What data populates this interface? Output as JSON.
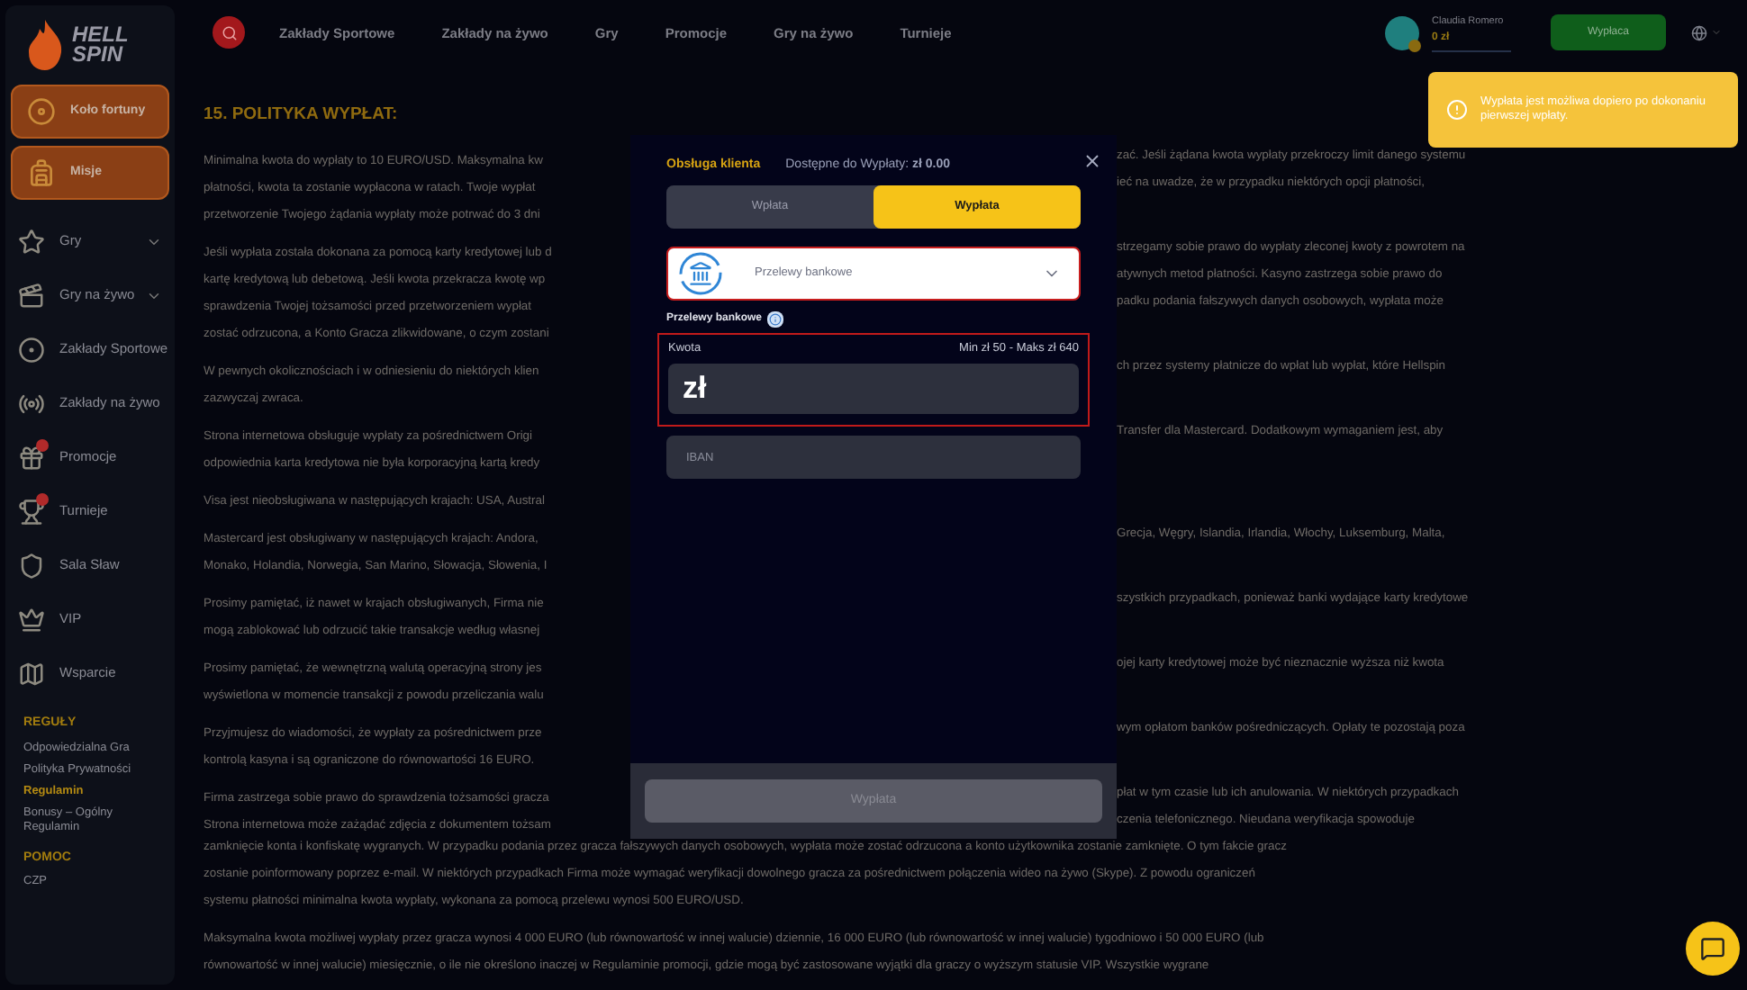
{
  "sidebar": {
    "logo": [
      "HELL",
      "SPIN"
    ],
    "promo_buttons": [
      "Koło fortuny",
      "Misje"
    ],
    "items": [
      {
        "label": "Gry",
        "submenu": true,
        "badge": false
      },
      {
        "label": "Gry na żywo",
        "submenu": true,
        "badge": false
      },
      {
        "label": "Zakłady Sportowe",
        "submenu": false,
        "badge": false
      },
      {
        "label": "Zakłady na żywo",
        "submenu": false,
        "badge": false
      },
      {
        "label": "Promocje",
        "submenu": false,
        "badge": true
      },
      {
        "label": "Turnieje",
        "submenu": false,
        "badge": true
      },
      {
        "label": "Sala Sław",
        "submenu": false,
        "badge": false
      },
      {
        "label": "VIP",
        "submenu": false,
        "badge": false
      },
      {
        "label": "Wsparcie",
        "submenu": false,
        "badge": false
      }
    ],
    "sections": [
      {
        "title": "REGUŁY",
        "links": [
          {
            "label": "Odpowiedzialna Gra",
            "selected": false
          },
          {
            "label": "Polityka Prywatności",
            "selected": false
          },
          {
            "label": "Regulamin",
            "selected": true
          },
          {
            "label": "Bonusy – Ogólny Regulamin",
            "selected": false
          }
        ]
      },
      {
        "title": "POMOC",
        "links": [
          {
            "label": "CZP",
            "selected": false
          }
        ]
      }
    ]
  },
  "top_nav": {
    "links": [
      "Zakłady Sportowe",
      "Zakłady na żywo",
      "Gry",
      "Promocje",
      "Gry na żywo",
      "Turnieje"
    ],
    "user": {
      "name": "Claudia Romero",
      "balance": "0 zł",
      "level": 0
    },
    "withdraw_button": "Wypłaca"
  },
  "toast": {
    "message": "Wypłata jest możliwa dopiero po dokonaniu pierwszej wpłaty."
  },
  "content": {
    "heading": "15. POLITYKA WYPŁAT:",
    "paragraphs": [
      [
        {
          "left": "Minimalna kwota do wypłaty to 10 EURO/USD. Maksymalna kw",
          "right": "zać. Jeśli żądana kwota wypłaty przekroczy limit danego systemu"
        },
        {
          "left": "płatności, kwota ta zostanie wypłacona w ratach. Twoje wypłat",
          "right": "ieć na uwadze, że w przypadku niektórych opcji płatności,"
        },
        {
          "left": "przetworzenie Twojego żądania wypłaty może potrwać do 3 dni"
        }
      ],
      [
        {
          "left": "Jeśli wypłata została dokonana za pomocą karty kredytowej lub d",
          "right": "strzegamy sobie prawo do wypłaty zleconej kwoty z powrotem na"
        },
        {
          "left": "kartę kredytową lub debetową. Jeśli kwota przekracza kwotę wp",
          "right": "atywnych metod płatności. Kasyno zastrzega sobie prawo do"
        },
        {
          "left": "sprawdzenia Twojej tożsamości przed przetworzeniem wypłat",
          "right": "padku podania fałszywych danych osobowych, wypłata może"
        },
        {
          "left": "zostać odrzucona, a Konto Gracza zlikwidowane, o czym zostani"
        }
      ],
      [
        {
          "left": "W pewnych okolicznościach i w odniesieniu do niektórych klien",
          "right": "ch przez systemy płatnicze do wpłat lub wypłat, które Hellspin"
        },
        {
          "left": "zazwyczaj zwraca."
        }
      ],
      [
        {
          "left": "Strona internetowa obsługuje wypłaty za pośrednictwem Origi",
          "right": "Transfer dla Mastercard. Dodatkowym wymaganiem jest, aby"
        },
        {
          "left": "odpowiednia karta kredytowa nie była korporacyjną kartą kredy"
        }
      ],
      [
        {
          "left": "Visa jest nieobsługiwana w następujących krajach: USA, Austral"
        }
      ],
      [
        {
          "left": "Mastercard jest obsługiwany w następujących krajach: Andora,",
          "right": "Grecja, Węgry, Islandia, Irlandia, Włochy, Luksemburg, Malta,"
        },
        {
          "left": "Monako, Holandia, Norwegia, San Marino, Słowacja, Słowenia, I"
        }
      ],
      [
        {
          "left": "Prosimy pamiętać, iż nawet w krajach obsługiwanych, Firma nie",
          "right": "szystkich przypadkach, ponieważ banki wydające karty kredytowe"
        },
        {
          "left": "mogą zablokować lub odrzucić takie transakcje według własnej"
        }
      ],
      [
        {
          "left": "Prosimy pamiętać, że wewnętrzną walutą operacyjną strony jes",
          "right": "ojej karty kredytowej może być nieznacznie wyższa niż kwota"
        },
        {
          "left": "wyświetlona w momencie transakcji z powodu przeliczania walu"
        }
      ],
      [
        {
          "left": "Przyjmujesz do wiadomości, że wypłaty za pośrednictwem prze",
          "right": "wym opłatom banków pośredniczących. Opłaty te pozostają poza"
        },
        {
          "left": "kontrolą kasyna i są ograniczone do równowartości 16 EURO."
        }
      ],
      [
        {
          "left": "Firma zastrzega sobie prawo do sprawdzenia tożsamości gracza",
          "right": "płat w tym czasie lub ich anulowania. W niektórych przypadkach"
        },
        {
          "left": "Strona internetowa może zażądać zdjęcia z dokumentem tożsam",
          "right": "czenia telefonicznego. Nieudana weryfikacja spowoduje"
        },
        {
          "text": "zamknięcie konta i konfiskatę wygranych. W przypadku podania przez gracza fałszywych danych osobowych, wypłata może zostać odrzucona a konto użytkownika zostanie zamknięte. O tym fakcie gracz"
        },
        {
          "text": "zostanie poinformowany poprzez e-mail. W niektórych przypadkach Firma może wymagać weryfikacji dowolnego gracza za pośrednictwem połączenia wideo na żywo (Skype). Z powodu ograniczeń"
        },
        {
          "text": "systemu płatności minimalna kwota wypłaty, wykonana za pomocą przelewu wynosi 500 EURO/USD."
        }
      ],
      [
        {
          "text": "Maksymalna kwota możliwej wypłaty przez gracza wynosi 4 000 EURO (lub równowartość w innej walucie) dziennie, 16 000 EURO (lub równowartość w innej walucie) tygodniowo i 50 000 EURO (lub"
        },
        {
          "text": "równowartość w innej walucie) miesięcznie, o ile nie określono inaczej w Regulaminie promocji, gdzie mogą być zastosowane wyjątki dla graczy o wyższym statusie VIP. Wszystkie wygrane"
        }
      ]
    ]
  },
  "modal": {
    "support_link": "Obsługa klienta",
    "available": "Dostępne do Wypłaty: **zł 0.00**",
    "tabs": [
      {
        "label": "Wpłata",
        "selected": false
      },
      {
        "label": "Wypłata",
        "selected": true
      }
    ],
    "method_select": {
      "value": "Przelewy bankowe"
    },
    "method_label": "Przelewy bankowe",
    "amount": {
      "label": "Kwota",
      "limits": "Min zł 50 - Maks zł 640",
      "value": "zł"
    },
    "iban": {
      "placeholder": "IBAN"
    },
    "submit": {
      "label": "Wypłata",
      "disabled": true
    }
  }
}
